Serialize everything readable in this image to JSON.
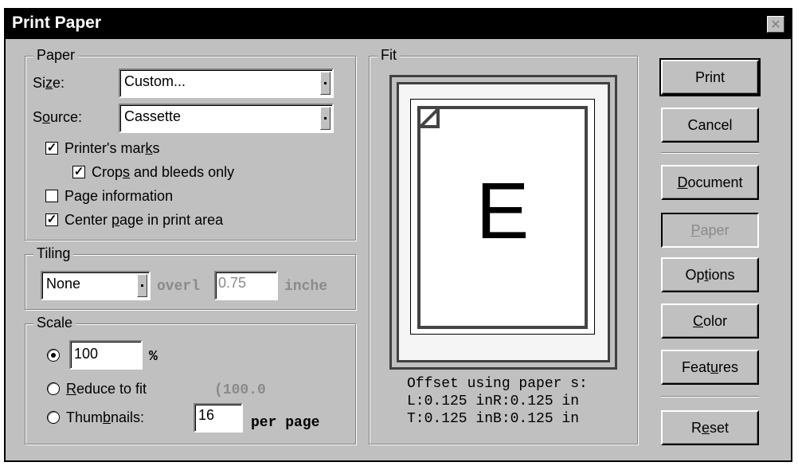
{
  "window": {
    "title": "Print Paper",
    "close_glyph": "✕"
  },
  "paper": {
    "legend": "Paper",
    "size_label": "Size:",
    "size_value": "Custom...",
    "source_label": "Source:",
    "source_value": "Cassette",
    "printers_marks": {
      "label": "Printer's marks",
      "checked": true
    },
    "crops_bleeds": {
      "label": "Crops and bleeds only",
      "checked": true
    },
    "page_information": {
      "label": "Page information",
      "checked": false
    },
    "center_page": {
      "label": "Center page in print area",
      "checked": true
    }
  },
  "tiling": {
    "legend": "Tiling",
    "mode_value": "None",
    "overlap_label": "overl",
    "overlap_value": "0.75",
    "overlap_unit": "inche"
  },
  "scale": {
    "legend": "Scale",
    "percent_value": "100",
    "percent_sign": "%",
    "reduce_label": "Reduce to fit",
    "reduce_value": "(100.0",
    "thumbnails_label": "Thumbnails:",
    "thumbnails_value": "16",
    "per_page_label": "per page",
    "selected": "percent"
  },
  "fit": {
    "legend": "Fit",
    "preview_letter": "E",
    "offset_line1": "Offset using paper s:",
    "offset_line2": "L:0.125 inR:0.125 in",
    "offset_line3": "T:0.125 inB:0.125 in"
  },
  "buttons": {
    "print": "Print",
    "cancel": "Cancel",
    "document": "Document",
    "paper": "Paper",
    "options": "Options",
    "color": "Color",
    "features": "Features",
    "reset": "Reset"
  },
  "icons": {
    "checkbox_check": "check-mark-icon",
    "dropdown": "dropdown-arrow-icon",
    "close": "close-icon",
    "page_corner": "folded-corner-icon"
  }
}
